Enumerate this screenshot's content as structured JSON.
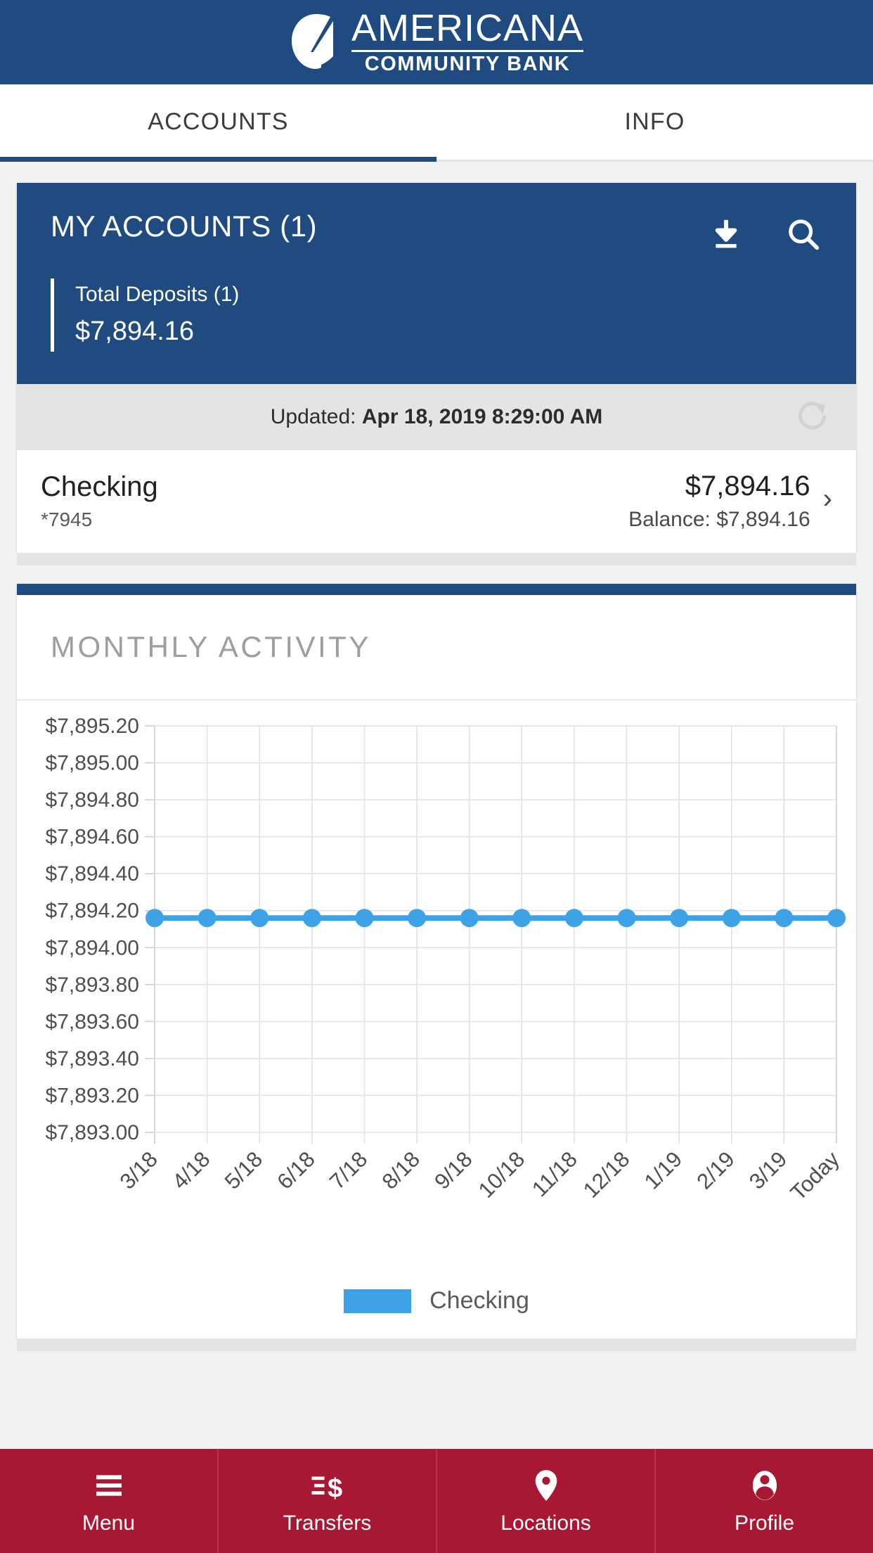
{
  "brand": {
    "name_top": "AMERICANA",
    "name_bottom": "COMMUNITY BANK",
    "bar_color": "#1f4b80"
  },
  "tabs": [
    {
      "label": "ACCOUNTS",
      "active": true
    },
    {
      "label": "INFO",
      "active": false
    }
  ],
  "accounts_card": {
    "title": "MY ACCOUNTS (1)",
    "download_icon": "download-icon",
    "search_icon": "search-icon",
    "total_label": "Total Deposits (1)",
    "total_amount": "$7,894.16",
    "updated_prefix": "Updated: ",
    "updated_value": "Apr 18, 2019 8:29:00 AM",
    "refresh_icon": "refresh-icon",
    "row": {
      "name": "Checking",
      "number": "*7945",
      "amount": "$7,894.16",
      "balance": "Balance: $7,894.16",
      "chevron": "›"
    }
  },
  "chart_card": {
    "title": "MONTHLY ACTIVITY",
    "accent_color": "#1f4b80"
  },
  "chart_data": {
    "type": "line",
    "title": "MONTHLY ACTIVITY",
    "xlabel": "",
    "ylabel": "",
    "grid": true,
    "legend_position": "bottom",
    "line_color": "#3da2e6",
    "categories": [
      "3/18",
      "4/18",
      "5/18",
      "6/18",
      "7/18",
      "8/18",
      "9/18",
      "10/18",
      "11/18",
      "12/18",
      "1/19",
      "2/19",
      "3/19",
      "Today"
    ],
    "ytick_labels": [
      "$7,895.20",
      "$7,895.00",
      "$7,894.80",
      "$7,894.60",
      "$7,894.40",
      "$7,894.20",
      "$7,894.00",
      "$7,893.80",
      "$7,893.60",
      "$7,893.40",
      "$7,893.20",
      "$7,893.00"
    ],
    "ytick_values": [
      7895.2,
      7895.0,
      7894.8,
      7894.6,
      7894.4,
      7894.2,
      7894.0,
      7893.8,
      7893.6,
      7893.4,
      7893.2,
      7893.0
    ],
    "ylim": [
      7893.0,
      7895.2
    ],
    "series": [
      {
        "name": "Checking",
        "color": "#3da2e6",
        "values": [
          7894.16,
          7894.16,
          7894.16,
          7894.16,
          7894.16,
          7894.16,
          7894.16,
          7894.16,
          7894.16,
          7894.16,
          7894.16,
          7894.16,
          7894.16,
          7894.16
        ]
      }
    ],
    "legend": [
      {
        "label": "Checking",
        "color": "#3da2e6"
      }
    ]
  },
  "bottom_nav": [
    {
      "label": "Menu",
      "icon": "hamburger-menu-icon"
    },
    {
      "label": "Transfers",
      "icon": "transfers-dollar-icon"
    },
    {
      "label": "Locations",
      "icon": "map-pin-icon"
    },
    {
      "label": "Profile",
      "icon": "person-icon"
    }
  ]
}
